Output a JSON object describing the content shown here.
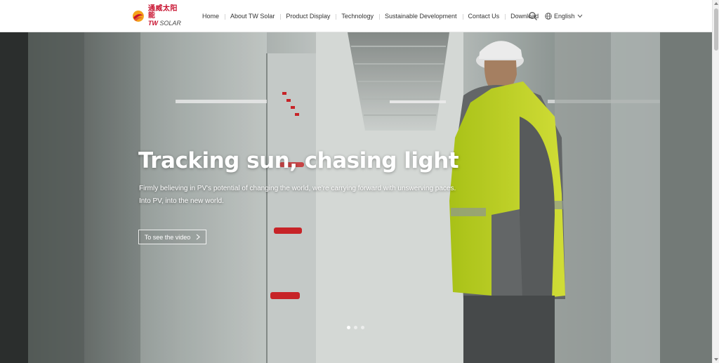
{
  "brand": {
    "logo_cn": "通威太阳能",
    "logo_en_prefix": "TW",
    "logo_en_suffix": " SOLAR",
    "accent_color": "#c8102e",
    "logo_sun_color": "#f5a21b"
  },
  "nav": {
    "items": [
      {
        "label": "Home"
      },
      {
        "label": "About TW Solar"
      },
      {
        "label": "Product Display"
      },
      {
        "label": "Technology"
      },
      {
        "label": "Sustainable Development"
      },
      {
        "label": "Contact Us"
      },
      {
        "label": "Download"
      }
    ],
    "search_icon": "search-icon",
    "language": {
      "label": "English",
      "icon": "globe-icon"
    }
  },
  "hero": {
    "title": "Tracking sun, chasing light",
    "subtitle_line1": "Firmly believing in PV's potential of changing the world, we're carrying forward with unswerving paces.",
    "subtitle_line2": "Into PV, into the new world.",
    "video_button": "To see the video",
    "slides_count": 3,
    "active_slide": 1
  }
}
